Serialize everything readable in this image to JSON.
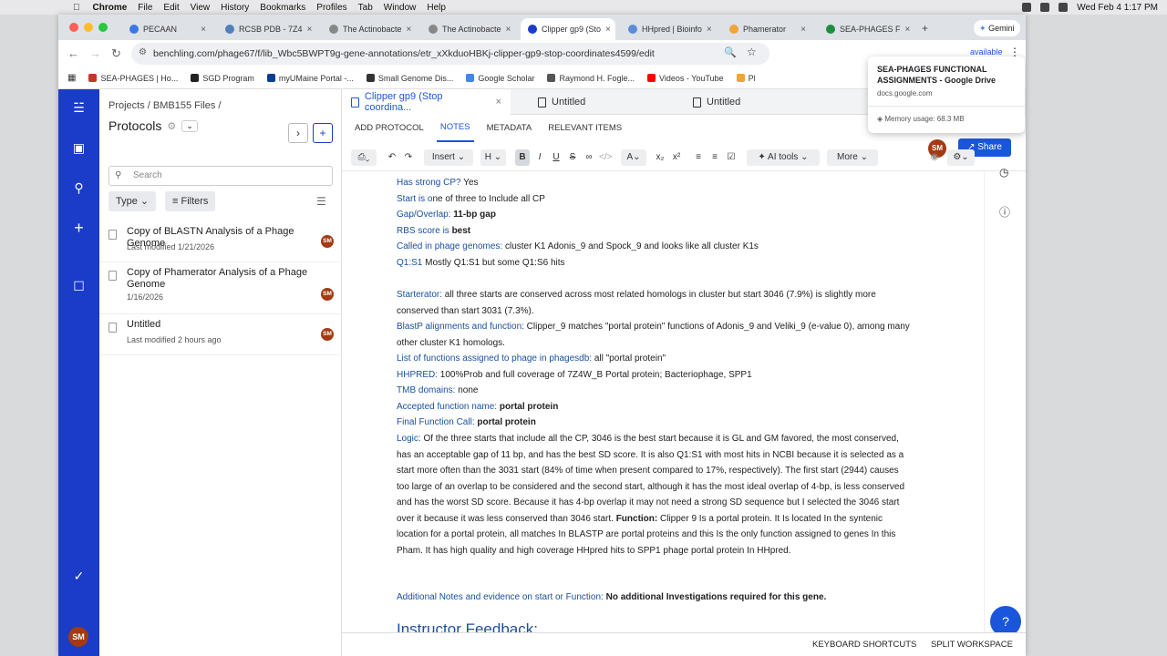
{
  "mac": {
    "app": "Chrome",
    "menus": [
      "File",
      "Edit",
      "View",
      "History",
      "Bookmarks",
      "Profiles",
      "Tab",
      "Window",
      "Help"
    ],
    "clock": "Wed Feb 4  1:17 PM"
  },
  "browser": {
    "tabs": [
      {
        "title": "PECAAN",
        "color": "#3b78e7"
      },
      {
        "title": "RCSB PDB - 7Z4",
        "color": "#4f81bd"
      },
      {
        "title": "The Actinobacte",
        "color": "#888888"
      },
      {
        "title": "The Actinobacte",
        "color": "#888888"
      },
      {
        "title": "Clipper gp9 (Sto",
        "color": "#1a3cc8"
      },
      {
        "title": "HHpred | Bioinfo",
        "color": "#5b8dd6"
      },
      {
        "title": "Phamerator",
        "color": "#f2a33a"
      },
      {
        "title": "SEA-PHAGES F",
        "color": "#1e8e3e"
      }
    ],
    "new_tab": "+",
    "gemini": "Gemini",
    "url": "benchling.com/phage67/f/lib_Wbc5BWPT9g-gene-annotations/etr_xXkduoHBKj-clipper-gp9-stop-coordinates4599/edit",
    "update_label": "available",
    "bookmarks": [
      {
        "label": "SEA-PHAGES | Ho...",
        "color": "#c0392b"
      },
      {
        "label": "SGD Program",
        "color": "#222222"
      },
      {
        "label": "myUMaine Portal -...",
        "color": "#0b3d91"
      },
      {
        "label": "Small Genome Dis...",
        "color": "#333333"
      },
      {
        "label": "Google Scholar",
        "color": "#4285f4"
      },
      {
        "label": "Raymond H. Fogle...",
        "color": "#555555"
      },
      {
        "label": "Videos - YouTube",
        "color": "#ff0000"
      },
      {
        "label": "Pl",
        "color": "#f2a33a"
      }
    ]
  },
  "tooltip": {
    "title": "SEA-PHAGES FUNCTIONAL ASSIGNMENTS - Google Drive",
    "domain": "docs.google.com",
    "memory": "Memory usage: 68.3 MB"
  },
  "files": {
    "breadcrumb": "Projects / BMB155 Files /",
    "title": "Protocols",
    "search_placeholder": "Search",
    "type_label": "Type",
    "filters_label": "Filters",
    "items": [
      {
        "name": "Copy of BLASTN Analysis of a Phage Genome",
        "date": "Last modified 1/21/2026",
        "initials": "SM"
      },
      {
        "name": "Copy of Phamerator Analysis of a Phage Genome",
        "date": "1/16/2026",
        "initials": "SM"
      },
      {
        "name": "Untitled",
        "date": "Last modified 2 hours ago",
        "initials": "SM"
      }
    ],
    "user_initials": "SM"
  },
  "editor": {
    "doc_tabs": [
      "Clipper gp9 (Stop coordina...",
      "Untitled",
      "Untitled"
    ],
    "sub_tabs": [
      "ADD PROTOCOL",
      "NOTES",
      "METADATA",
      "RELEVANT ITEMS"
    ],
    "share": "Share",
    "user_initials": "SM",
    "toolbar": {
      "insert": "Insert",
      "heading": "H",
      "ai": "AI tools",
      "more": "More"
    },
    "lines": [
      {
        "label": "Has strong CP?",
        "text": " Yes",
        "bold": false
      },
      {
        "label": "Start is o",
        "text": "ne of three to Include all CP",
        "bold": false
      },
      {
        "label": "Gap/Overlap:",
        "text": " 11-bp gap",
        "bold": true
      },
      {
        "label": "RBS score is",
        "text": " best",
        "bold": true
      },
      {
        "label": "Called in phage genomes:",
        "text": " cluster K1 Adonis_9 and Spock_9 and looks like all cluster K1s",
        "bold": false
      },
      {
        "label": "Q1:S1",
        "text": " Mostly Q1:S1 but some Q1:S6 hits",
        "bold": false
      }
    ],
    "starterator_label": "Starterator:",
    "starterator_text": " all three starts are conserved across most related homologs in cluster but start 3046 (7.9%) is slightly more conserved than start 3031 (7.3%).",
    "blastp_label": "BlastP alignments and function:",
    "blastp_text": " Clipper_9 matches \"portal protein\" functions of Adonis_9 and Veliki_9 (e-value 0), among many other cluster K1 homologs.",
    "lines2": [
      {
        "label": "List of functions assigned to phage in phagesdb:",
        "text": " all \"portal protein\"",
        "bold": false
      },
      {
        "label": "HHPRED:",
        "text": " 100%Prob and full coverage of   7Z4W_B Portal protein; Bacteriophage, SPP1",
        "bold": false
      },
      {
        "label": "TMB domains:",
        "text": " none",
        "bold": false
      },
      {
        "label": "Accepted function name:",
        "text": " portal protein",
        "bold": true
      },
      {
        "label": "Final Function Call:",
        "text": " portal protein",
        "bold": true
      }
    ],
    "logic_label": "Logic:",
    "logic_text": " Of the three starts that include all the CP, 3046 is the best start because it is GL and GM favored, the most conserved, has an acceptable gap of 11 bp, and has the best SD score. It is also Q1:S1 with most hits in NCBI because it is selected as a start more often than the 3031 start (84% of time when present compared to 17%, respectively). The first start (2944) causes too large of an overlap to be considered and the second start, although it has the most ideal overlap of 4-bp, is less conserved and has the worst SD score. Because it has 4-bp overlap it may not need a strong SD sequence but I selected the 3046 start over it because it was less conserved than 3046 start. ",
    "function_label": "Function:",
    "function_text": " Clipper 9 Is a portal protein. It Is located In the syntenic location for a portal protein, all matches In BLASTP are portal proteins and this Is the only function assigned to genes In this Pham. It has high quality and high coverage HHpred hits to SPP1 phage portal protein In HHpred.",
    "additional_label": "Additional Notes and evidence on start or Function:",
    "additional_text": " No additional Investigations required for this gene.",
    "heading_cut": "Instructor Feedback:",
    "footer": {
      "shortcuts": "KEYBOARD SHORTCUTS",
      "split": "SPLIT WORKSPACE"
    },
    "help": "?"
  },
  "colors": {
    "brand": "#1a3cc8",
    "link_label": "#1a4f9c",
    "avatar": "#a33a13"
  }
}
